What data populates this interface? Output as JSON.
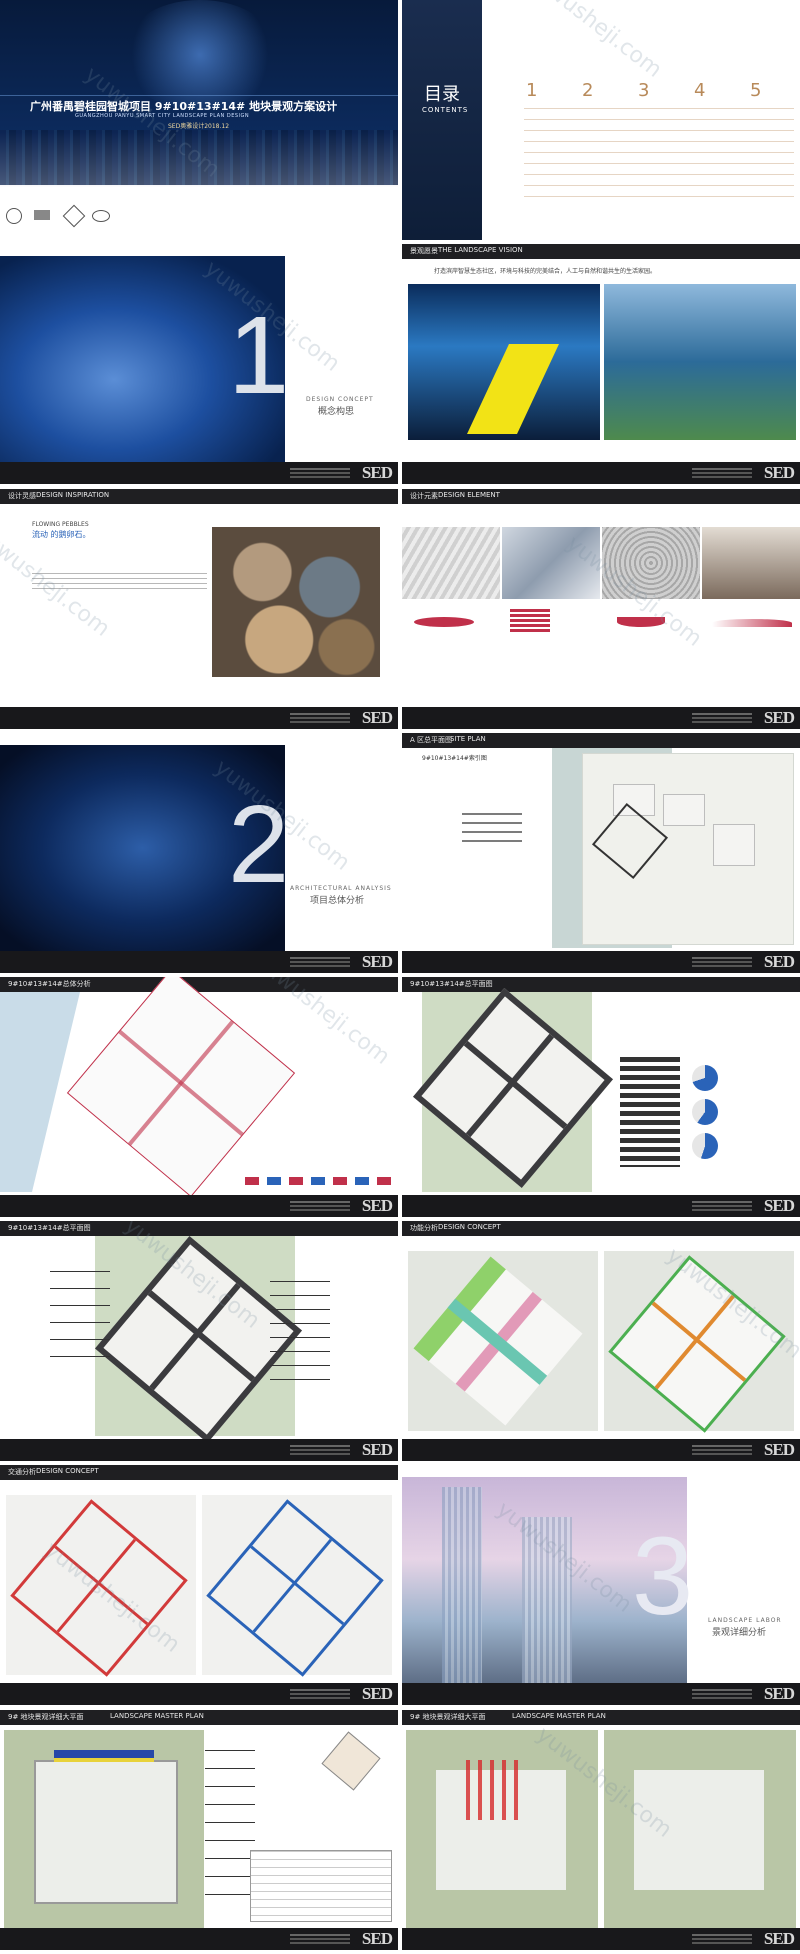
{
  "cover": {
    "title_cn": "广州番禺碧桂园智城项目 9#10#13#14# 地块景观方案设计",
    "title_en": "GUANGZHOU PANYU SMART CITY LANDSCAPE PLAN DESIGN",
    "date": "SED奥雅设计2018.12"
  },
  "contents": {
    "title_cn": "目录",
    "title_en": "CONTENTS",
    "numbers": [
      "1",
      "2",
      "3",
      "4",
      "5"
    ]
  },
  "section1": {
    "number": "1",
    "en": "DESIGN CONCEPT",
    "cn": "概念构思"
  },
  "vision": {
    "header_cn": "景观愿景",
    "header_en": "THE LANDSCAPE VISION",
    "heading": "打造滨岸智慧生态社区，环境与科技的完美结合，人工与自然和谐共生的生活家园。"
  },
  "inspiration": {
    "header_cn": "设计灵感",
    "header_en": "DESIGN INSPIRATION",
    "en": "FLOWING PEBBLES",
    "cn": "流动 的鹅卵石。"
  },
  "elements": {
    "header_cn": "设计元素",
    "header_en": "DESIGN ELEMENT"
  },
  "section2": {
    "number": "2",
    "en": "ARCHITECTURAL ANALYSIS",
    "cn": "项目总体分析"
  },
  "plan_a": {
    "header_cn": "A 区总平面图",
    "header_en": "SITE PLAN",
    "sub": "9#10#13#14#索引图"
  },
  "plan_b": {
    "header": "9#10#13#14#总体分析"
  },
  "plan_c": {
    "header": "9#10#13#14#总平面图"
  },
  "plan_d": {
    "header": "9#10#13#14#总平面图"
  },
  "func": {
    "header_cn": "功能分析",
    "header_en": "DESIGN CONCEPT"
  },
  "traffic": {
    "header_cn": "交通分析",
    "header_en": "DESIGN CONCEPT"
  },
  "section3": {
    "number": "3",
    "en": "LANDSCAPE LABOR",
    "cn": "景观详细分析"
  },
  "detail1": {
    "header": "9# 地块景观详细大平面",
    "sub": "LANDSCAPE MASTER PLAN"
  },
  "detail2": {
    "header": "9# 地块景观详细大平面",
    "sub": "LANDSCAPE MASTER PLAN"
  },
  "watermark": "yuwusheji.com",
  "logo": "SED",
  "colors": {
    "dark_bar": "#1f1f22",
    "navy": "#0e2146",
    "accent_red": "#c0304a",
    "accent_blue": "#2a63b8"
  }
}
